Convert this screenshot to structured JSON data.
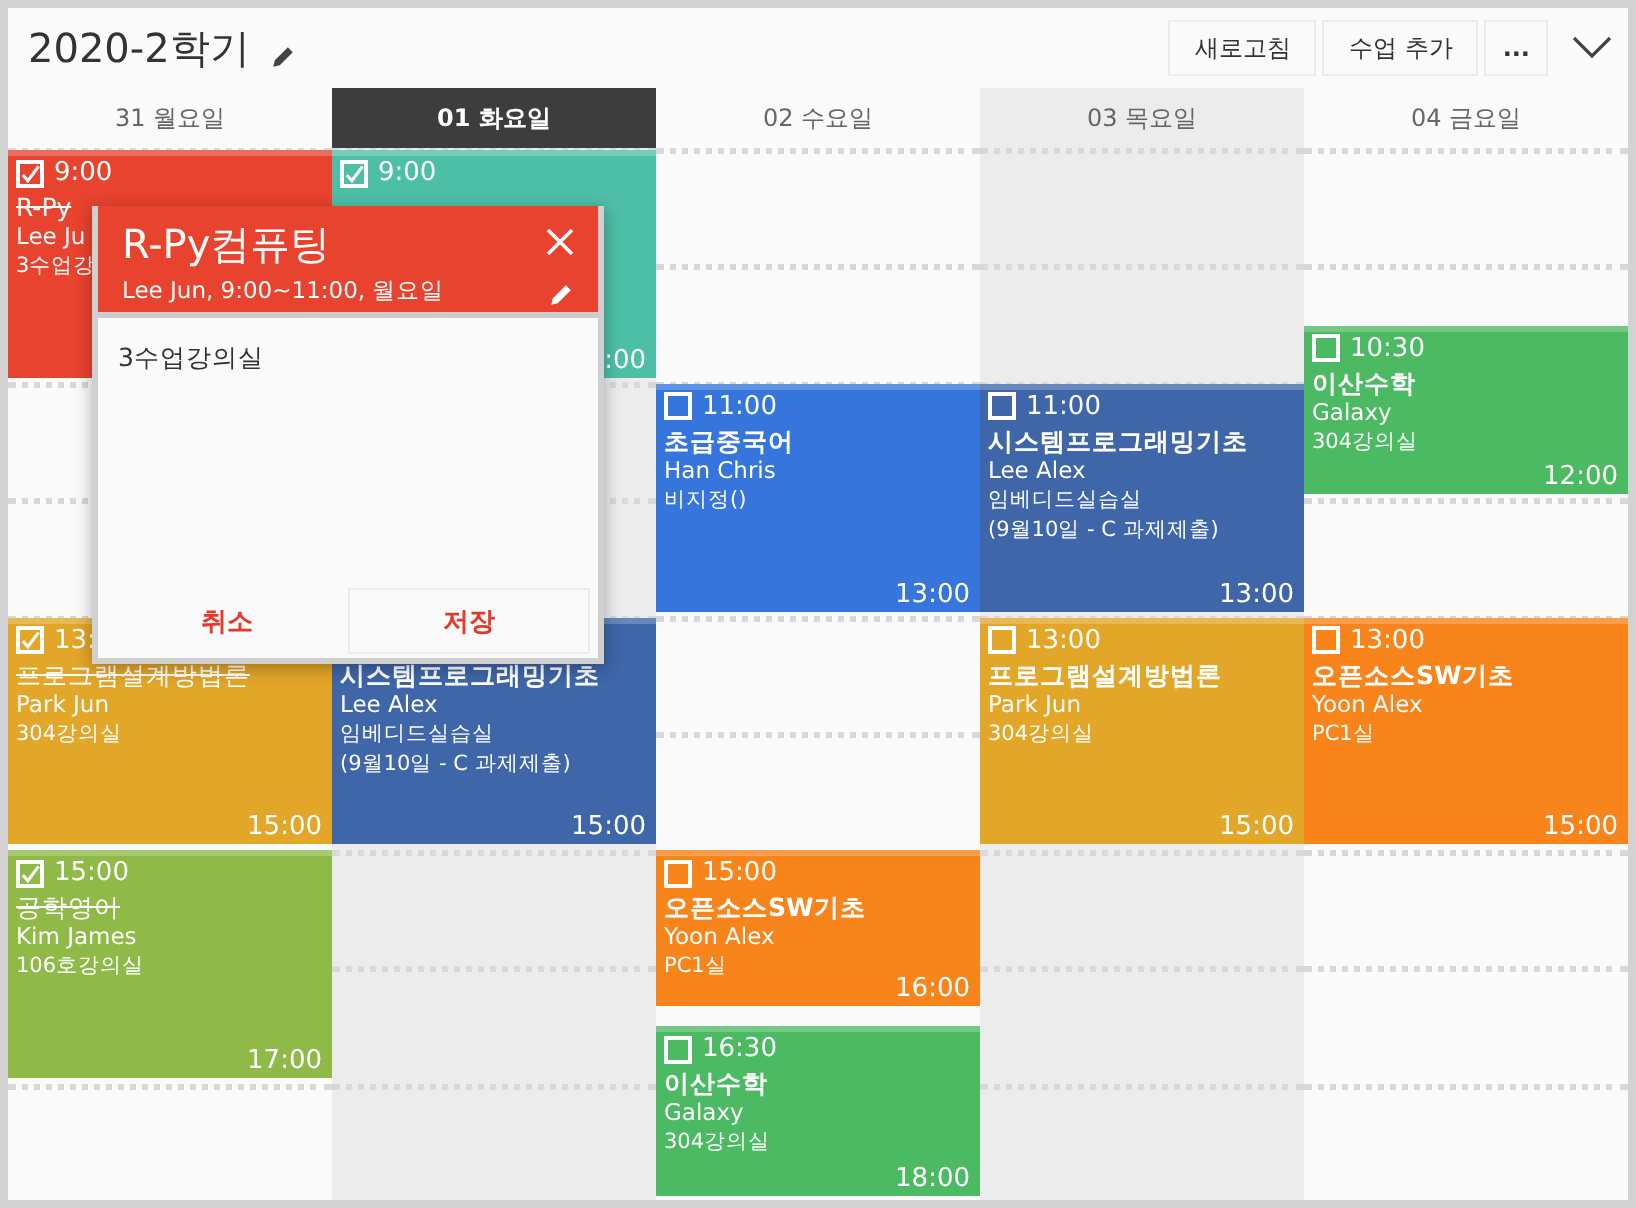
{
  "title": "2020-2학기",
  "toolbar": [
    "새로고침",
    "수업 추가",
    "..."
  ],
  "days": [
    {
      "label": "31 월요일",
      "selected": false,
      "shaded": false,
      "events": [
        {
          "start": "9:00",
          "title": "R-Py",
          "instructor": "Lee Ju",
          "room": "3수업강",
          "done": true,
          "color": "#e8432e"
        },
        {
          "start": "13:",
          "end": "15:00",
          "title": "프로그램설계방법론",
          "instructor": "Park Jun",
          "room": "304강의실",
          "done": true,
          "color": "#e2a628"
        },
        {
          "start": "15:00",
          "end": "17:00",
          "title": "공학영어",
          "instructor": "Kim James",
          "room": "106호강의실",
          "done": true,
          "color": "#8fba48"
        }
      ]
    },
    {
      "label": "01 화요일",
      "selected": true,
      "shaded": true,
      "events": [
        {
          "start": "9:00",
          "end": ":00",
          "done": true,
          "color": "#4dbfa7"
        },
        {
          "end": "15:00",
          "title": "시스템프로그래밍기초",
          "instructor": "Lee Alex",
          "room": "임베디드실습실",
          "note": "(9월10일 - C 과제제출)",
          "color": "#3e66a8"
        }
      ]
    },
    {
      "label": "02 수요일",
      "selected": false,
      "shaded": false,
      "events": [
        {
          "start": "11:00",
          "end": "13:00",
          "title": "초급중국어",
          "instructor": "Han Chris",
          "room": "비지정()",
          "done": false,
          "color": "#3575dc"
        },
        {
          "start": "15:00",
          "end": "16:00",
          "title": "오픈소스SW기초",
          "instructor": "Yoon Alex",
          "room": "PC1실",
          "done": false,
          "color": "#f7851b"
        },
        {
          "start": "16:30",
          "end": "18:00",
          "title": "이산수학",
          "instructor": "Galaxy",
          "room": "304강의실",
          "done": false,
          "color": "#4cba62"
        }
      ]
    },
    {
      "label": "03 목요일",
      "selected": false,
      "shaded": true,
      "events": [
        {
          "start": "11:00",
          "end": "13:00",
          "title": "시스템프로그래밍기초",
          "instructor": "Lee Alex",
          "room": "임베디드실습실",
          "note": "(9월10일 - C 과제제출)",
          "done": false,
          "color": "#3e66a8"
        },
        {
          "start": "13:00",
          "end": "15:00",
          "title": "프로그램설계방법론",
          "instructor": "Park Jun",
          "room": "304강의실",
          "done": false,
          "color": "#e2a628"
        }
      ]
    },
    {
      "label": "04 금요일",
      "selected": false,
      "shaded": false,
      "events": [
        {
          "start": "10:30",
          "end": "12:00",
          "title": "이산수학",
          "instructor": "Galaxy",
          "room": "304강의실",
          "done": false,
          "color": "#4cba62"
        },
        {
          "start": "13:00",
          "end": "15:00",
          "title": "오픈소스SW기초",
          "instructor": "Yoon Alex",
          "room": "PC1실",
          "done": false,
          "color": "#f7851b"
        }
      ]
    }
  ],
  "popup": {
    "title": "R-Py컴퓨팅",
    "subtitle": "Lee Jun, 9:00~11:00, 월요일",
    "body": "3수업강의실",
    "buttons": [
      {
        "label": "취소",
        "primary": false
      },
      {
        "label": "저장",
        "primary": true
      }
    ]
  }
}
